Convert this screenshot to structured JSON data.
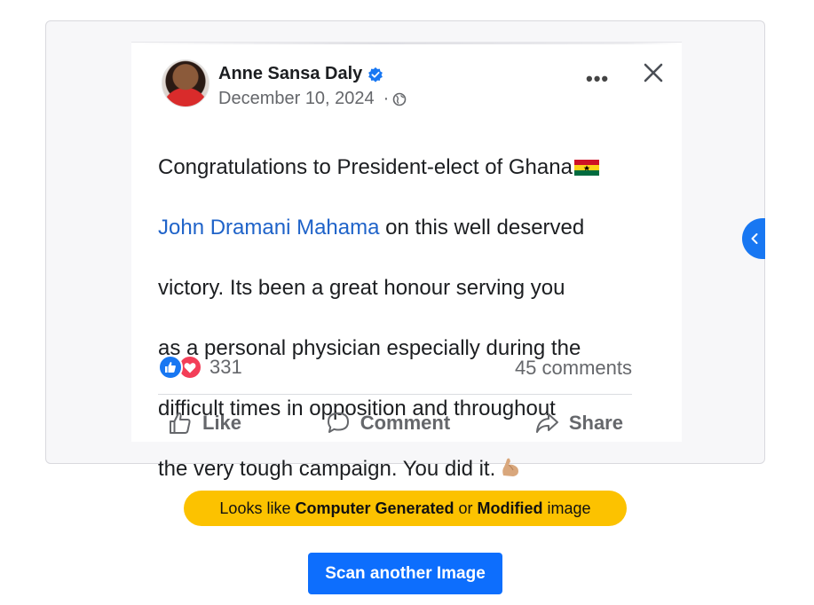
{
  "post": {
    "author": "Anne Sansa Daly",
    "date": "December 10, 2024",
    "date_separator": "·",
    "body_line1": "Congratulations to President-elect of Ghana",
    "body_link": "John Dramani Mahama",
    "body_line2_rest": " on this well deserved",
    "body_line3": "victory. Its been a great honour serving you",
    "body_line4": "as a personal physician especially during the",
    "body_line5": "difficult times in opposition and throughout",
    "body_line6": "the very tough campaign. You did it.",
    "reaction_count": "331",
    "comments": "45 comments",
    "actions": {
      "like": "Like",
      "comment": "Comment",
      "share": "Share"
    }
  },
  "result": {
    "prefix": "Looks like",
    "strong1": "Computer Generated",
    "middle": "or",
    "strong2": "Modified",
    "suffix": "image"
  },
  "scan_button": "Scan another Image",
  "icons": {
    "verified": "verified-badge-icon",
    "globe": "globe-icon",
    "more": "more-options-icon",
    "close": "close-icon",
    "flag": "ghana-flag-icon",
    "muscle": "flexed-biceps-icon",
    "like_reaction": "like-reaction-icon",
    "love_reaction": "love-reaction-icon",
    "side_tab": "chevron-left-icon"
  },
  "colors": {
    "accent": "#1877f2",
    "link": "#1f63c9",
    "verdict_bg": "#fcc200",
    "button_bg": "#0d6efd"
  }
}
